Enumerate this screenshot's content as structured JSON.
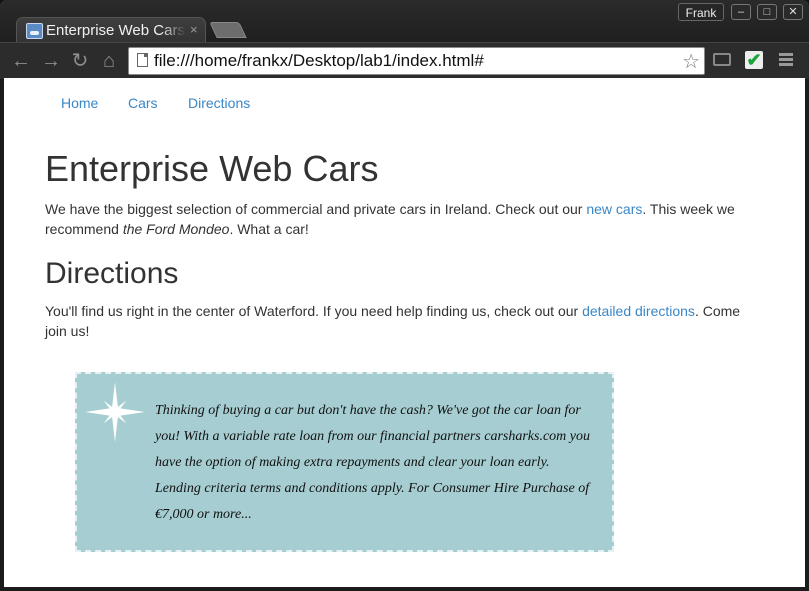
{
  "browser": {
    "tab_title": "Enterprise Web Cars",
    "tab_close": "×",
    "profile_name": "Frank",
    "window_controls": {
      "minimize": "–",
      "maximize": "□",
      "close": "✕"
    },
    "url": "file:///home/frankx/Desktop/lab1/index.html#",
    "icons": {
      "back": "arrow-left-icon",
      "forward": "arrow-right-icon",
      "reload": "reload-icon",
      "home": "home-icon",
      "bookmark": "star-icon",
      "cast": "cast-icon",
      "extension": "checkmark-extension-icon",
      "menu": "hamburger-menu-icon"
    }
  },
  "nav": {
    "items": [
      "Home",
      "Cars",
      "Directions"
    ],
    "link_color": "#3a87c7"
  },
  "main": {
    "title": "Enterprise Web Cars",
    "intro": {
      "part1": "We have the biggest selection of commercial and private cars in Ireland. Check out our ",
      "link": "new cars",
      "part2": ". This week we recommend ",
      "emphasis": "the Ford Mondeo",
      "part3": ". What a car!"
    },
    "directions_heading": "Directions",
    "directions": {
      "part1": "You'll find us right in the center of Waterford. If you need help finding us, check out our ",
      "link": "detailed directions",
      "part2": ". Come join us!"
    }
  },
  "promo": {
    "text": "Thinking of buying a car but don't have the cash? We've got the car loan for you! With a variable rate loan from our financial partners carsharks.com you have the option of making extra repayments and clear your loan early. Lending criteria terms and conditions apply. For Consumer Hire Purchase of €7,000 or more...",
    "background": "#a6cdd1",
    "icon": "sparkle-icon"
  }
}
